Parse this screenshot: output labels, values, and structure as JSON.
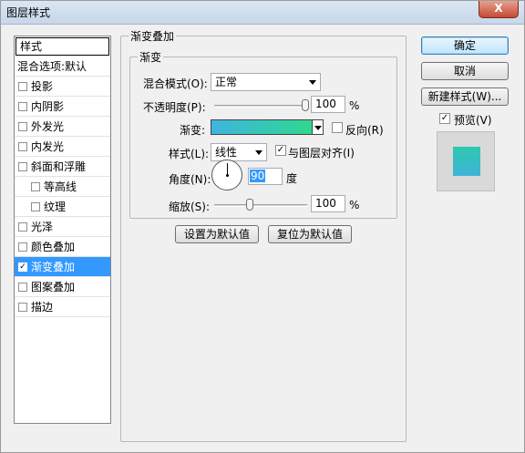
{
  "window": {
    "title": "图层样式",
    "close_label": "X"
  },
  "left_panel": {
    "header": "样式",
    "items": [
      {
        "label": "混合选项:默认",
        "checkbox": false,
        "checked": false,
        "indent": 0,
        "selected": false
      },
      {
        "label": "投影",
        "checkbox": true,
        "checked": false,
        "indent": 0,
        "selected": false
      },
      {
        "label": "内阴影",
        "checkbox": true,
        "checked": false,
        "indent": 0,
        "selected": false
      },
      {
        "label": "外发光",
        "checkbox": true,
        "checked": false,
        "indent": 0,
        "selected": false
      },
      {
        "label": "内发光",
        "checkbox": true,
        "checked": false,
        "indent": 0,
        "selected": false
      },
      {
        "label": "斜面和浮雕",
        "checkbox": true,
        "checked": false,
        "indent": 0,
        "selected": false
      },
      {
        "label": "等高线",
        "checkbox": true,
        "checked": false,
        "indent": 1,
        "selected": false
      },
      {
        "label": "纹理",
        "checkbox": true,
        "checked": false,
        "indent": 1,
        "selected": false
      },
      {
        "label": "光泽",
        "checkbox": true,
        "checked": false,
        "indent": 0,
        "selected": false
      },
      {
        "label": "颜色叠加",
        "checkbox": true,
        "checked": false,
        "indent": 0,
        "selected": false
      },
      {
        "label": "渐变叠加",
        "checkbox": true,
        "checked": true,
        "indent": 0,
        "selected": true
      },
      {
        "label": "图案叠加",
        "checkbox": true,
        "checked": false,
        "indent": 0,
        "selected": false
      },
      {
        "label": "描边",
        "checkbox": true,
        "checked": false,
        "indent": 0,
        "selected": false
      }
    ]
  },
  "gradient_overlay": {
    "group_title": "渐变叠加",
    "subgroup_title": "渐变",
    "blend_mode_label": "混合模式(O):",
    "blend_mode_value": "正常",
    "opacity_label": "不透明度(P):",
    "opacity_value": "100",
    "opacity_fraction": 1.0,
    "percent_unit": "%",
    "gradient_label": "渐变:",
    "gradient_colors": [
      "#40b4e0",
      "#2ed890"
    ],
    "reverse_label": "反向(R)",
    "reverse_checked": false,
    "style_label": "样式(L):",
    "style_value": "线性",
    "align_label": "与图层对齐(I)",
    "align_checked": true,
    "angle_label": "角度(N):",
    "angle_value": "90",
    "angle_unit": "度",
    "scale_label": "缩放(S):",
    "scale_value": "100",
    "scale_fraction": 0.4,
    "set_default_label": "设置为默认值",
    "reset_default_label": "复位为默认值"
  },
  "right_panel": {
    "ok_label": "确定",
    "cancel_label": "取消",
    "new_style_label": "新建样式(W)...",
    "preview_label": "预览(V)",
    "preview_checked": true,
    "preview_colors": [
      "#2ec8b0",
      "#3fb3d8"
    ]
  }
}
